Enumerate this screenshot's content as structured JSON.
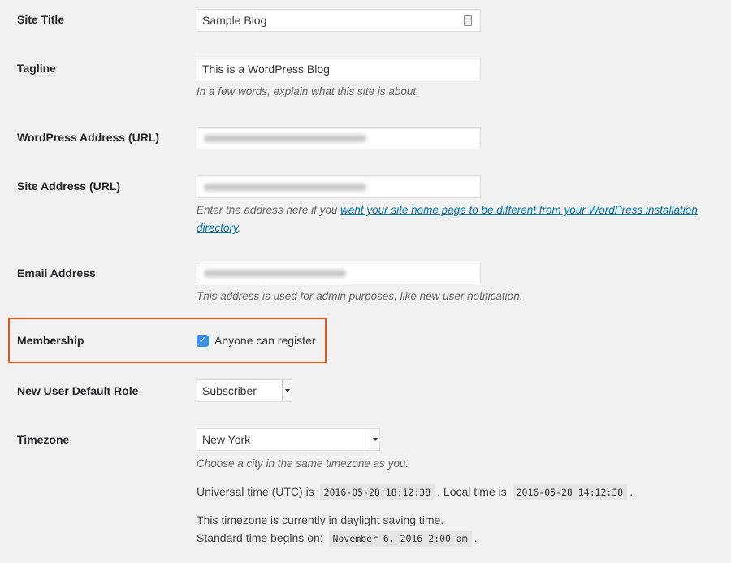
{
  "fields": {
    "site_title": {
      "label": "Site Title",
      "value": "Sample Blog",
      "icon": "contact-card-icon"
    },
    "tagline": {
      "label": "Tagline",
      "value": "This is a WordPress Blog",
      "description": "In a few words, explain what this site is about."
    },
    "wp_address": {
      "label": "WordPress Address (URL)"
    },
    "site_address": {
      "label": "Site Address (URL)",
      "description_prefix": "Enter the address here if you ",
      "description_link": "want your site home page to be different from your WordPress installation directory",
      "description_suffix": "."
    },
    "email": {
      "label": "Email Address",
      "description": "This address is used for admin purposes, like new user notification."
    },
    "membership": {
      "label": "Membership",
      "checkbox_label": "Anyone can register",
      "checked": true,
      "highlight_color": "#e2561c"
    },
    "default_role": {
      "label": "New User Default Role",
      "value": "Subscriber"
    },
    "timezone": {
      "label": "Timezone",
      "value": "New York",
      "description": "Choose a city in the same timezone as you.",
      "utc_prefix": "Universal time (UTC) is",
      "utc_time": "2016-05-28 18:12:38",
      "local_prefix": ". Local time is",
      "local_time": "2016-05-28 14:12:38",
      "local_suffix": ".",
      "dst_line": "This timezone is currently in daylight saving time.",
      "standard_prefix": "Standard time begins on:",
      "standard_time": "November 6, 2016 2:00 am",
      "standard_suffix": "."
    }
  }
}
